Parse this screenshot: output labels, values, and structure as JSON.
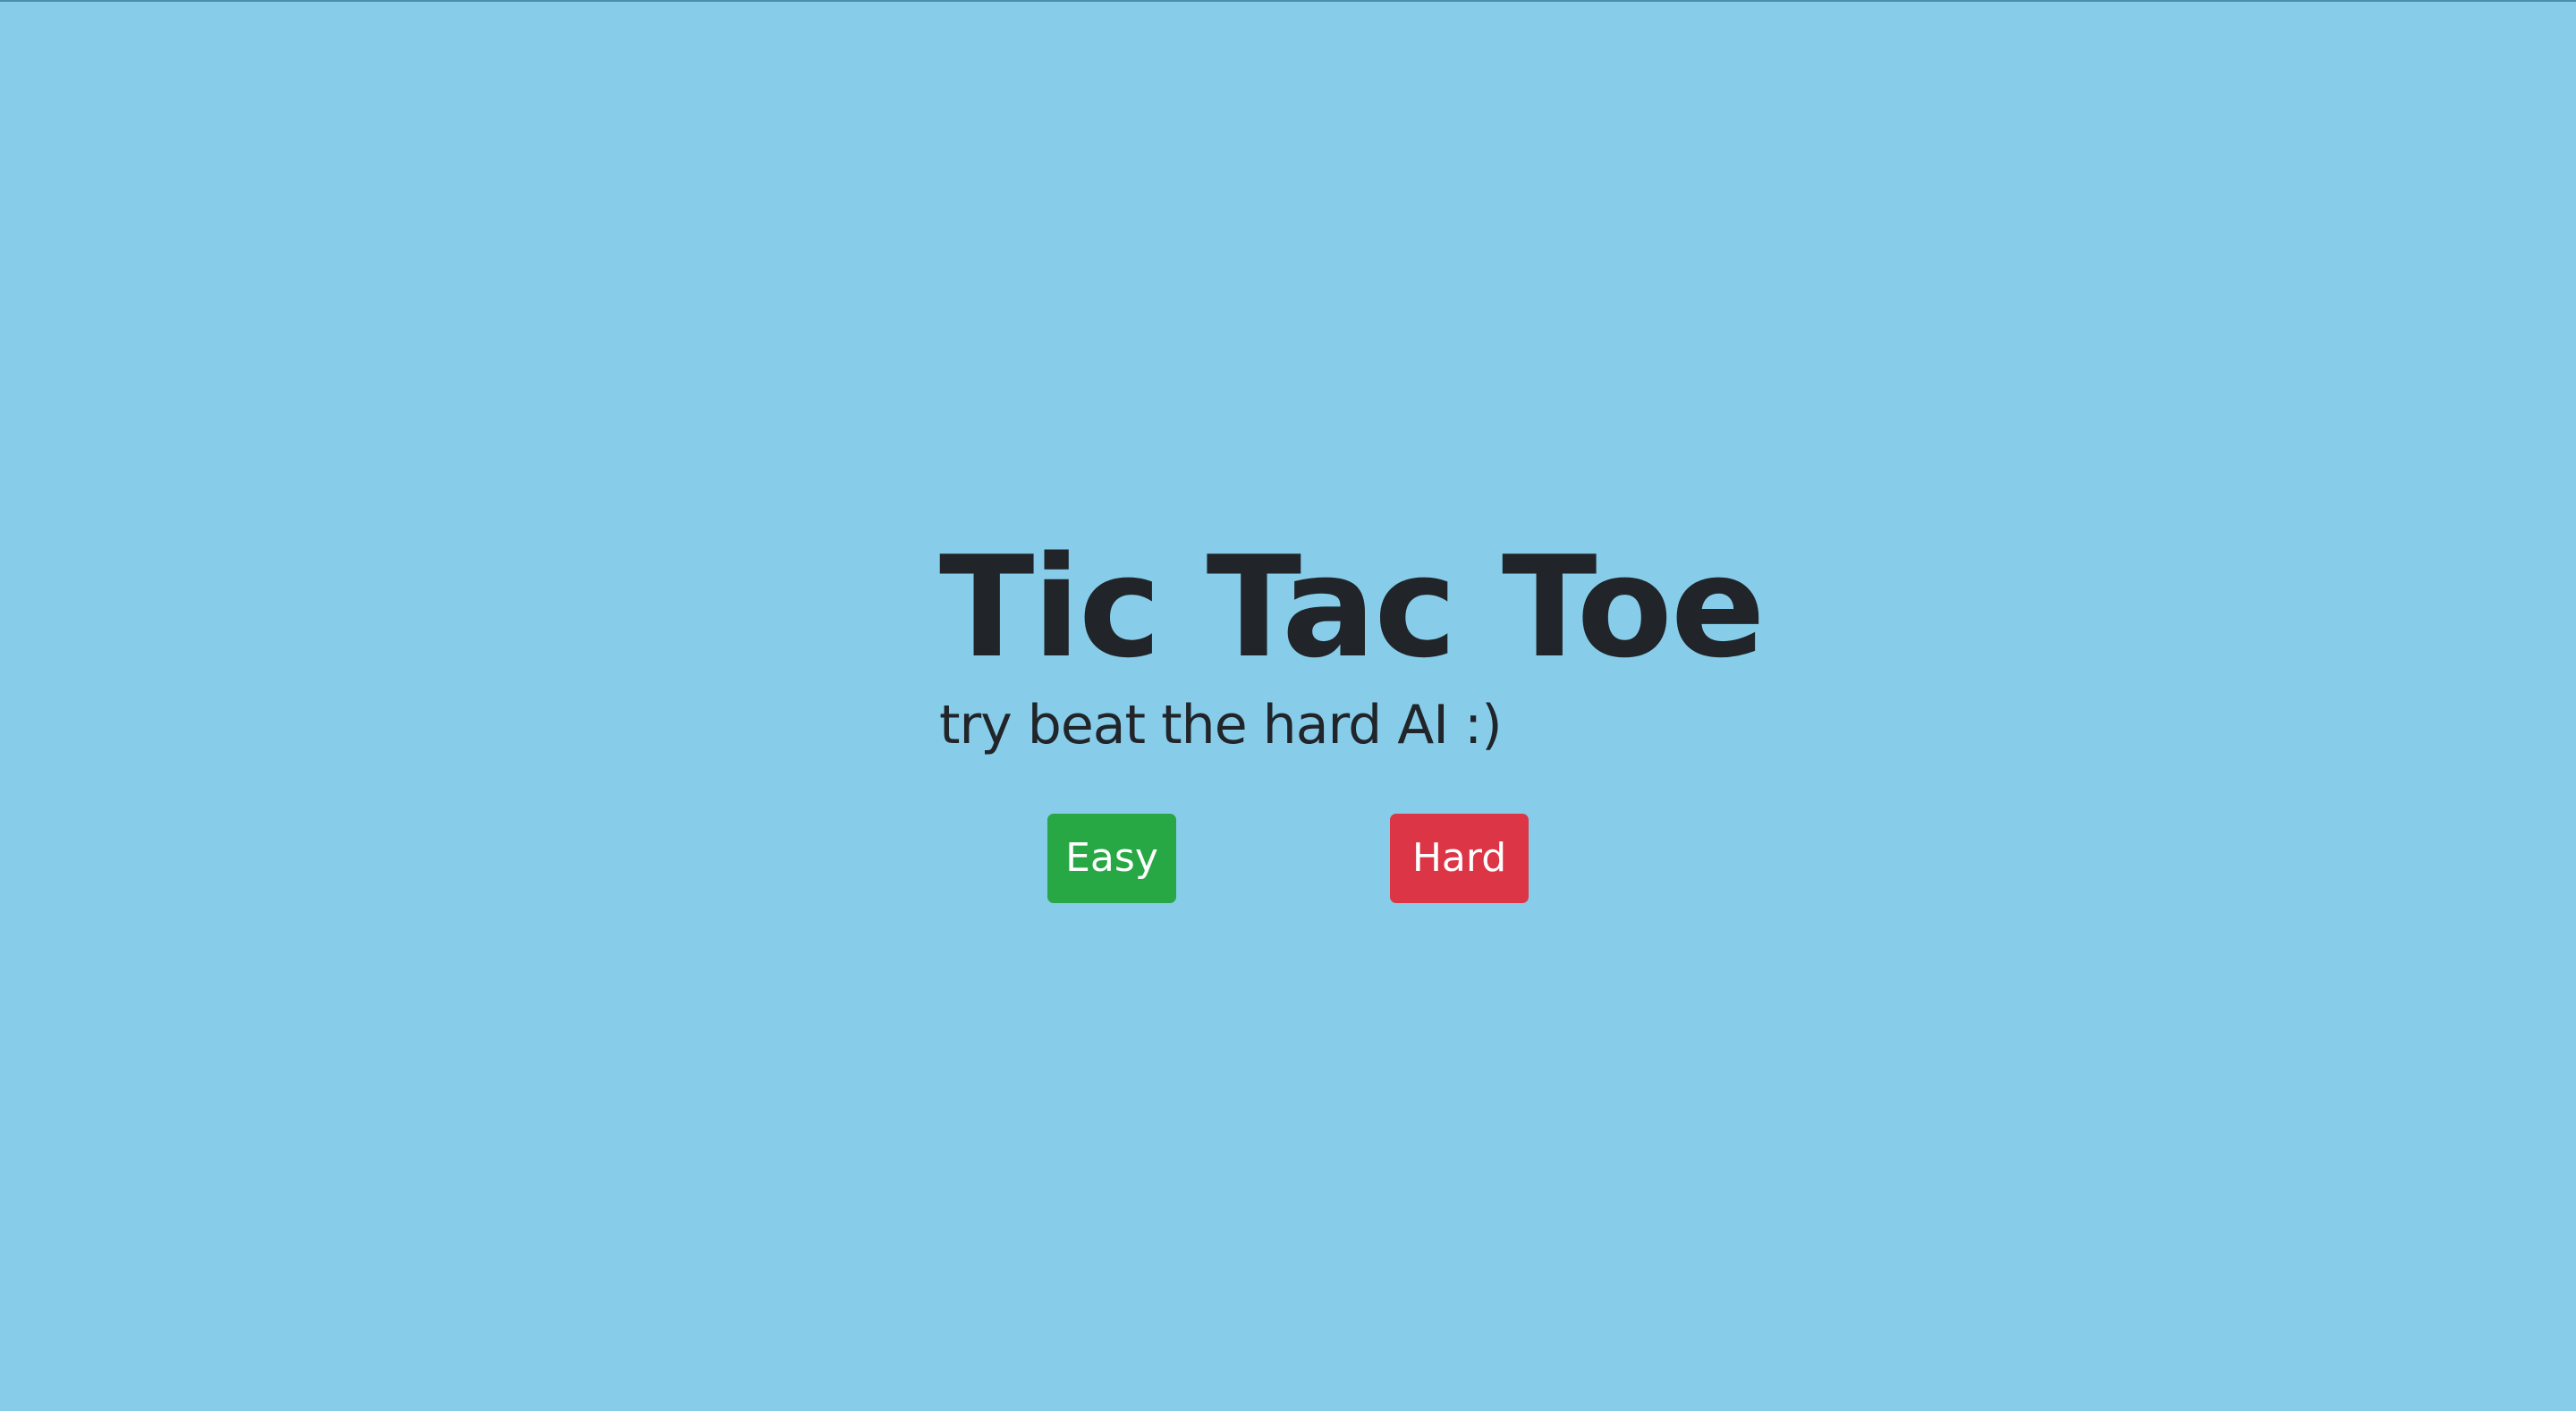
{
  "page": {
    "title": "Tic Tac Toe",
    "subtitle": "try beat the hard AI :)"
  },
  "difficulty": {
    "easy_label": "Easy",
    "hard_label": "Hard"
  },
  "colors": {
    "background": "#87cdea",
    "text": "#212529",
    "easy": "#28a745",
    "hard": "#dc3545"
  }
}
